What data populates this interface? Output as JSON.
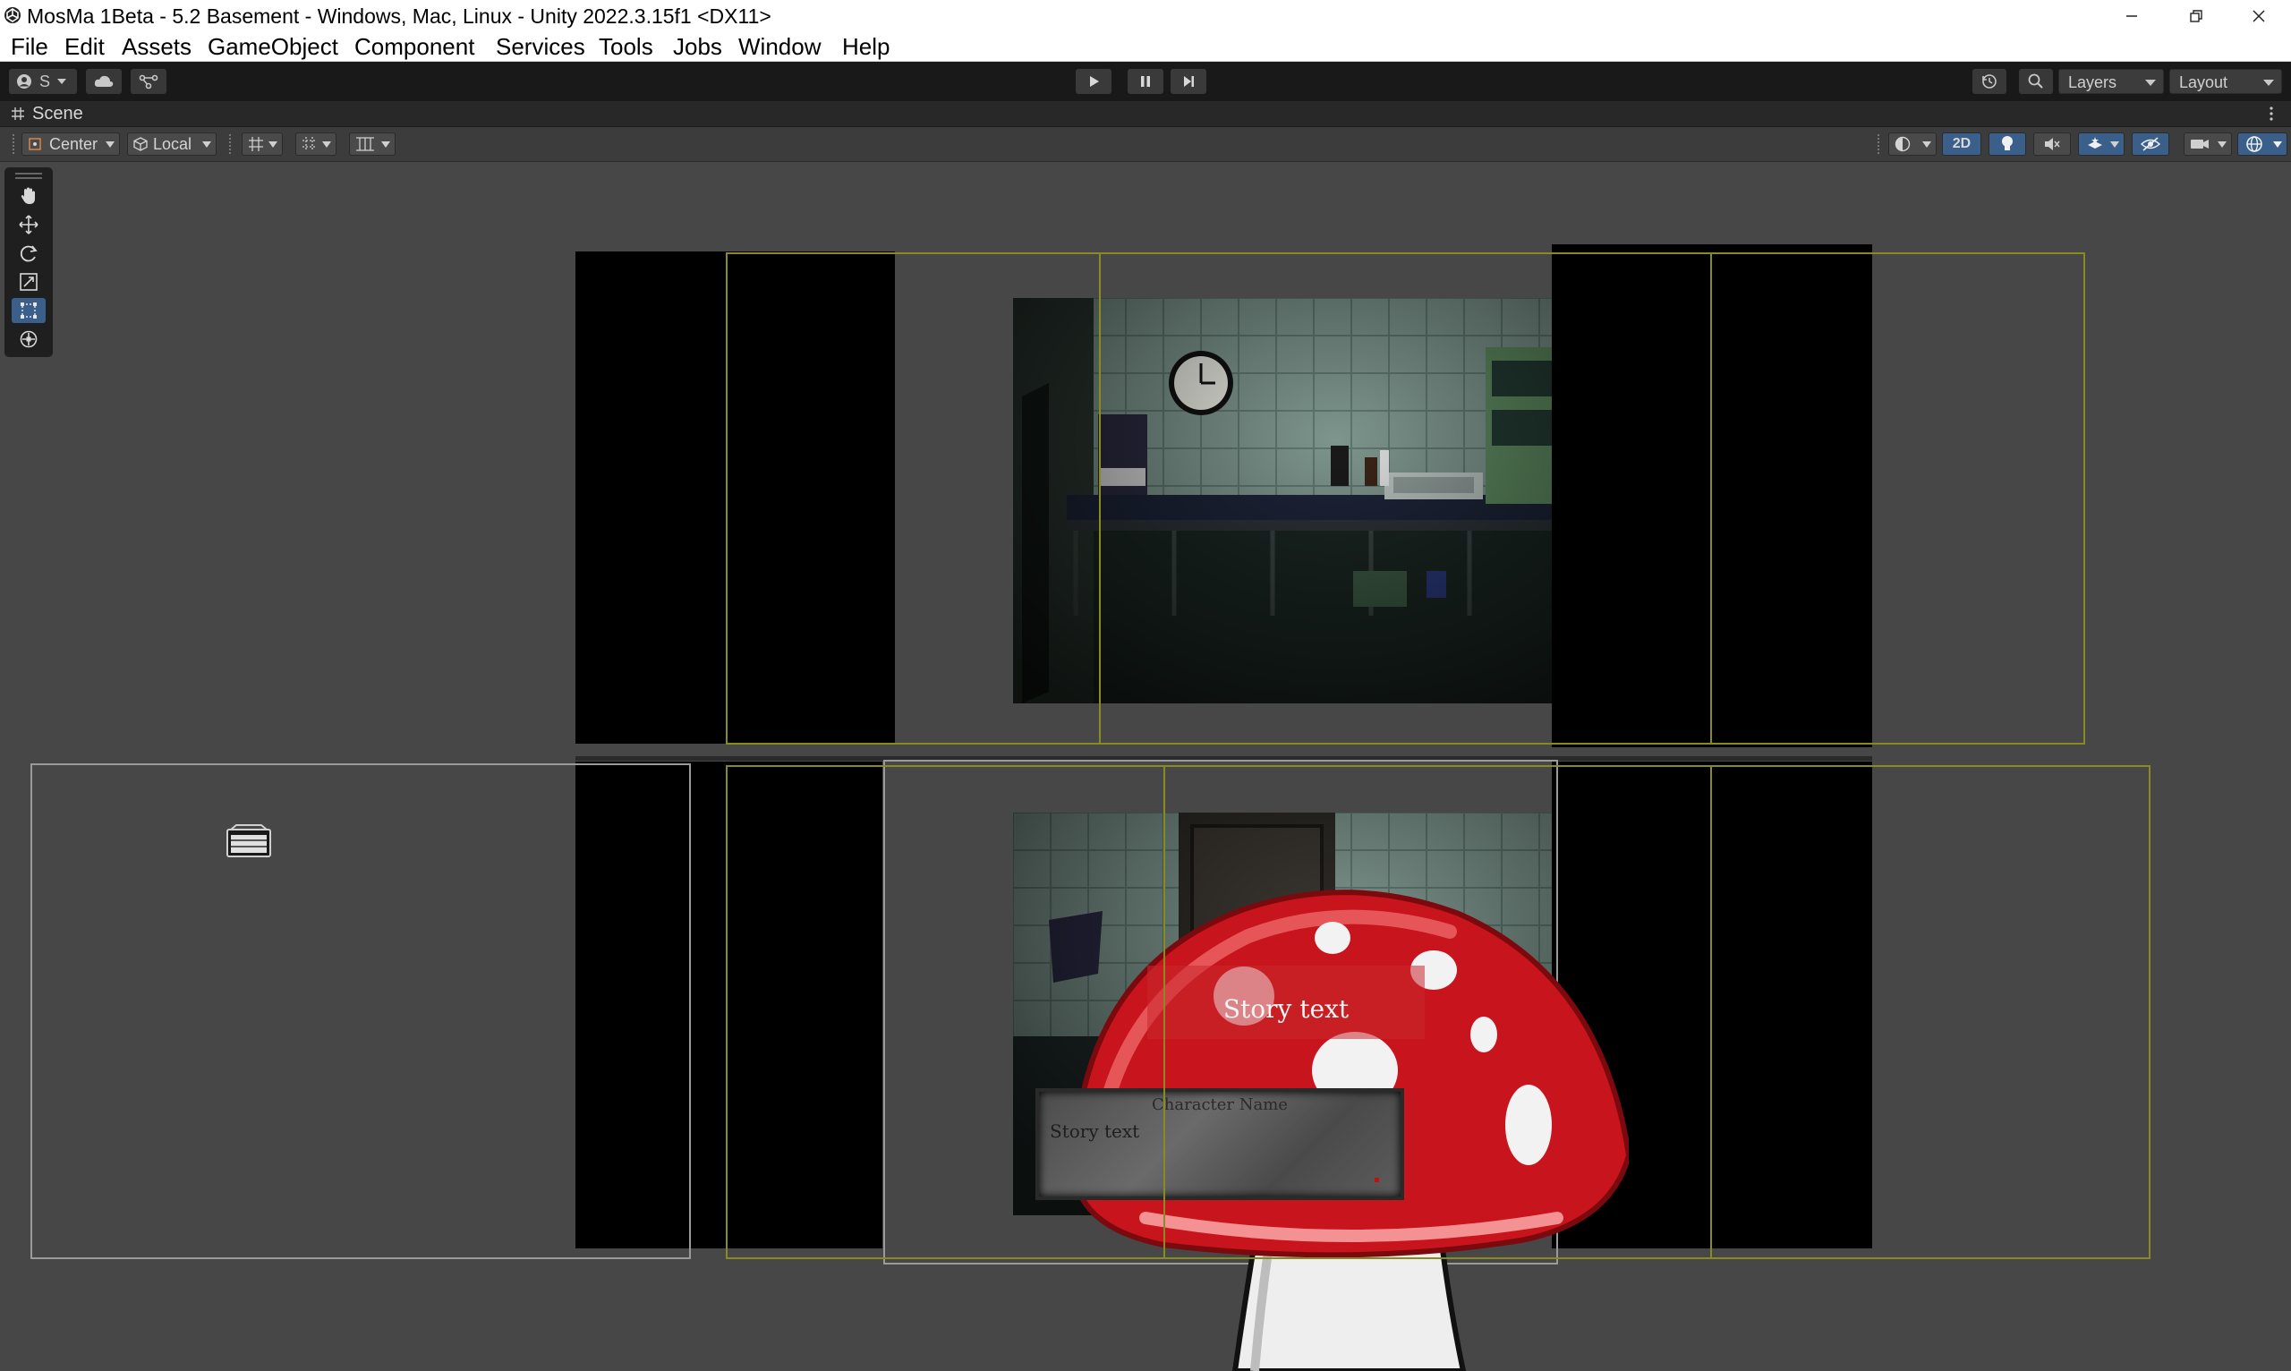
{
  "window": {
    "title": "MosMa 1Beta - 5.2 Basement - Windows, Mac, Linux - Unity 2022.3.15f1 <DX11>"
  },
  "menu": {
    "items": [
      "File",
      "Edit",
      "Assets",
      "GameObject",
      "Component",
      "Services",
      "Tools",
      "Jobs",
      "Window",
      "Help"
    ]
  },
  "toolbar": {
    "account_label": "S",
    "layers_label": "Layers",
    "layout_label": "Layout"
  },
  "scene_tab": {
    "label": "Scene"
  },
  "scene_toolbar": {
    "pivot_label": "Center",
    "space_label": "Local",
    "mode_2d_label": "2D"
  },
  "scene": {
    "story_text_large": "Story text",
    "character_name": "Character Name",
    "story_text_small": "Story text"
  },
  "colors": {
    "editor_bg": "#474747",
    "toolbar_bg": "#191919",
    "active_blue": "#3a5f8a",
    "gizmo_yellow": "#8a8a22",
    "mushroom_red": "#c8141c"
  }
}
